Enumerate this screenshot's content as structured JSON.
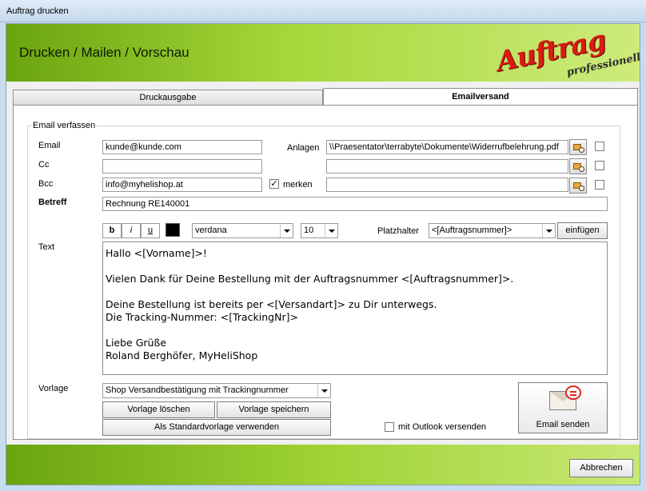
{
  "window": {
    "title": "Auftrag drucken"
  },
  "banner": {
    "heading": "Drucken / Mailen / Vorschau",
    "logo_main": "Auftrag",
    "logo_sub": "professionell"
  },
  "tabs": [
    {
      "label": "Druckausgabe"
    },
    {
      "label": "Emailversand"
    }
  ],
  "group": {
    "title": "Email verfassen"
  },
  "fields": {
    "email": {
      "label": "Email",
      "value": "kunde@kunde.com"
    },
    "cc": {
      "label": "Cc",
      "value": ""
    },
    "bcc": {
      "label": "Bcc",
      "value": "info@myhelishop.at",
      "remember_label": "merken",
      "remember_checked": "✓"
    },
    "betreff": {
      "label": "Betreff",
      "value": "Rechnung RE140001"
    },
    "anlagen": {
      "label": "Anlagen",
      "values": [
        "\\\\Praesentator\\terrabyte\\Dokumente\\Widerrufbelehrung.pdf",
        "",
        ""
      ]
    }
  },
  "format": {
    "bold": "b",
    "italic": "i",
    "underline": "u",
    "color": "#000000",
    "font": "verdana",
    "size": "10"
  },
  "placeholder": {
    "label": "Platzhalter",
    "selected": "<[Auftragsnummer]>",
    "insert_label": "einfügen"
  },
  "text": {
    "label": "Text",
    "lines": [
      "Hallo <[Vorname]>!",
      "",
      "Vielen Dank für Deine Bestellung mit der Auftragsnummer <[Auftragsnummer]>.",
      "",
      "Deine Bestellung ist bereits per <[Versandart]> zu Dir unterwegs.",
      "Die Tracking-Nummer: <[TrackingNr]>",
      "",
      "Liebe Grüße",
      "Roland Berghöfer, MyHeliShop"
    ]
  },
  "vorlage": {
    "label": "Vorlage",
    "selected": "Shop Versandbestätigung mit Trackingnummer",
    "delete_label": "Vorlage löschen",
    "save_label": "Vorlage speichern",
    "default_label": "Als Standardvorlage verwenden"
  },
  "outlook": {
    "label": "mit Outlook versenden"
  },
  "send": {
    "label": "Email senden"
  },
  "footer": {
    "cancel_label": "Abbrechen"
  }
}
